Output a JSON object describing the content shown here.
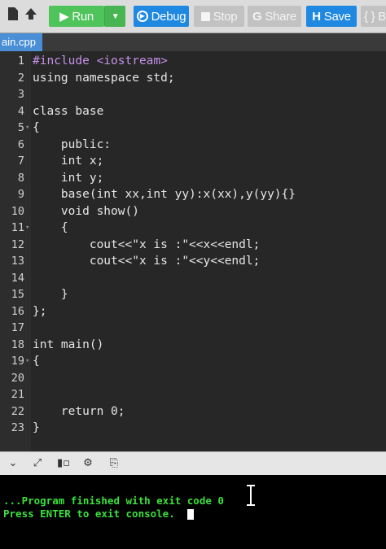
{
  "toolbar": {
    "run_label": "Run",
    "debug_label": "Debug",
    "stop_label": "Stop",
    "share_label": "Share",
    "save_label": "Save",
    "beautify_label": "{ } B",
    "left_icons": [
      "file-icon",
      "upload-icon"
    ]
  },
  "file_tab": {
    "name": "ain.cpp"
  },
  "editor": {
    "lines": [
      {
        "n": "1",
        "fold": "",
        "text": "#include <iostream>",
        "kind": "pp"
      },
      {
        "n": "2",
        "fold": "",
        "text": "using namespace std;",
        "kind": "plain"
      },
      {
        "n": "3",
        "fold": "",
        "text": "",
        "kind": "plain"
      },
      {
        "n": "4",
        "fold": "",
        "text": "class base",
        "kind": "plain"
      },
      {
        "n": "5",
        "fold": "▾",
        "text": "{",
        "kind": "plain"
      },
      {
        "n": "6",
        "fold": "",
        "text": "    public:",
        "kind": "plain"
      },
      {
        "n": "7",
        "fold": "",
        "text": "    int x;",
        "kind": "plain"
      },
      {
        "n": "8",
        "fold": "",
        "text": "    int y;",
        "kind": "plain"
      },
      {
        "n": "9",
        "fold": "",
        "text": "    base(int xx,int yy):x(xx),y(yy){}",
        "kind": "plain"
      },
      {
        "n": "10",
        "fold": "",
        "text": "    void show()",
        "kind": "plain"
      },
      {
        "n": "11",
        "fold": "▾",
        "text": "    {",
        "kind": "plain"
      },
      {
        "n": "12",
        "fold": "",
        "text": "        cout<<\"x is :\"<<x<<endl;",
        "kind": "plain"
      },
      {
        "n": "13",
        "fold": "",
        "text": "        cout<<\"x is :\"<<y<<endl;",
        "kind": "plain"
      },
      {
        "n": "14",
        "fold": "",
        "text": "",
        "kind": "plain"
      },
      {
        "n": "15",
        "fold": "",
        "text": "    }",
        "kind": "plain"
      },
      {
        "n": "16",
        "fold": "",
        "text": "};",
        "kind": "plain"
      },
      {
        "n": "17",
        "fold": "",
        "text": "",
        "kind": "plain"
      },
      {
        "n": "18",
        "fold": "",
        "text": "int main()",
        "kind": "plain"
      },
      {
        "n": "19",
        "fold": "▾",
        "text": "{",
        "kind": "plain"
      },
      {
        "n": "20",
        "fold": "",
        "text": "",
        "kind": "plain"
      },
      {
        "n": "21",
        "fold": "",
        "text": "",
        "kind": "plain"
      },
      {
        "n": "22",
        "fold": "",
        "text": "    return 0;",
        "kind": "plain"
      },
      {
        "n": "23",
        "fold": "",
        "text": "}",
        "kind": "plain"
      }
    ]
  },
  "console_bar": {
    "icons": [
      "chevron-down-icon",
      "expand-icon",
      "terminal-icon",
      "settings-icon",
      "copy-icon"
    ]
  },
  "console": {
    "line1": "...Program finished with exit code 0",
    "line2": "Press ENTER to exit console."
  },
  "colors": {
    "run": "#4ec45a",
    "debug": "#1f88e0",
    "save": "#1f88e0",
    "console_text": "#3be03b"
  }
}
